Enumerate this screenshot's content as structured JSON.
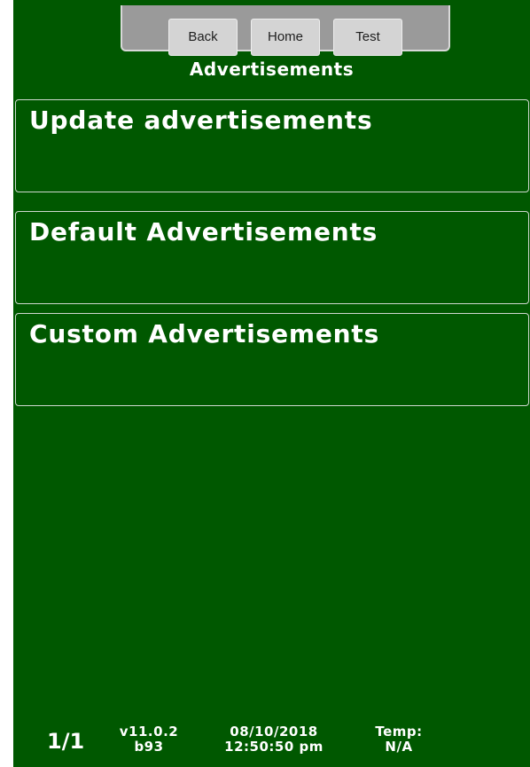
{
  "nav": {
    "back_label": "Back",
    "home_label": "Home",
    "test_label": "Test"
  },
  "page": {
    "title": "Advertisements"
  },
  "menu": {
    "items": [
      {
        "label": "Update advertisements"
      },
      {
        "label": "Default Advertisements"
      },
      {
        "label": "Custom Advertisements"
      }
    ]
  },
  "footer": {
    "page_count": "1/1",
    "version": "v11.0.2",
    "build": "b93",
    "date": "08/10/2018",
    "time": "12:50:50 pm",
    "temp_label": "Temp:",
    "temp_value": "N/A"
  },
  "colors": {
    "background": "#005800",
    "text": "#ffffff",
    "nav_tray": "#9a9a9a",
    "nav_button": "#d4d4d4"
  }
}
